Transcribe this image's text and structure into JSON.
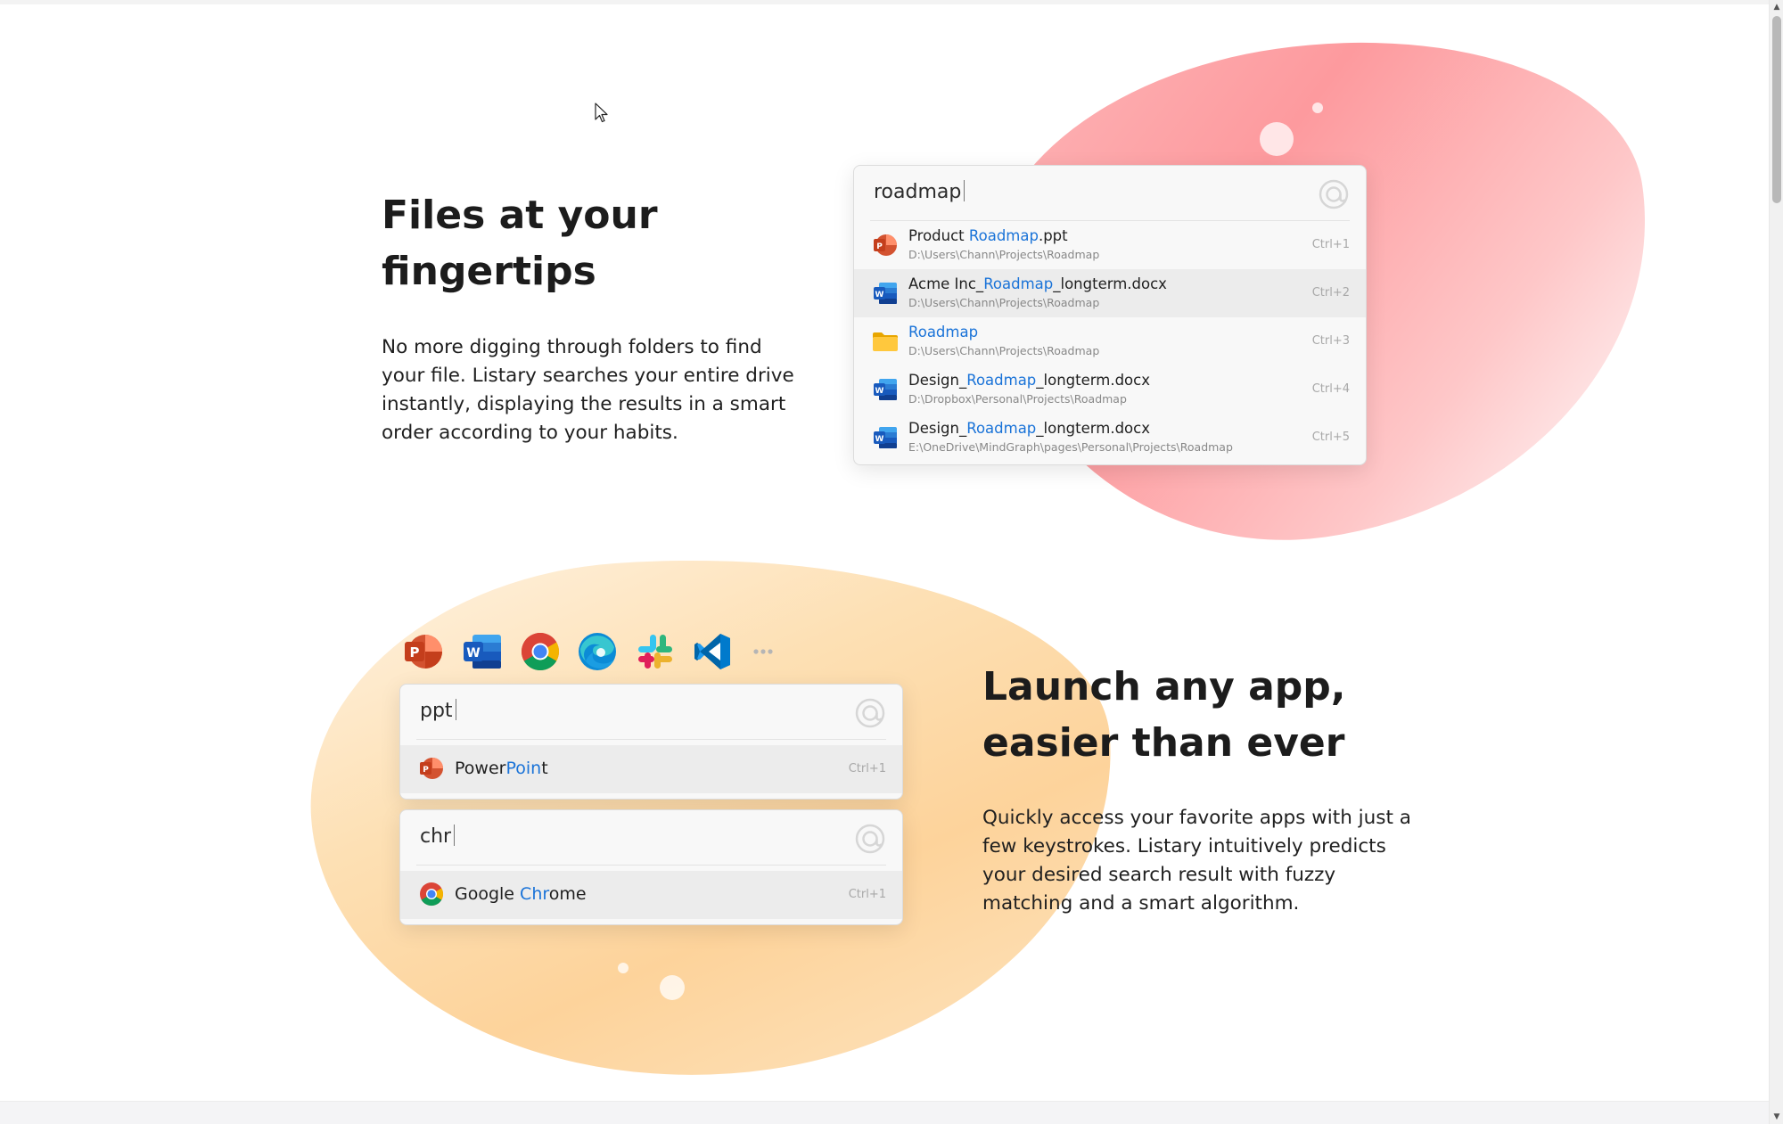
{
  "section1": {
    "heading_line1": "Files at your",
    "heading_line2": "fingertips",
    "para_line1": "No more digging through folders to find",
    "para_line2": "your file. Listary searches your entire drive",
    "para_line3": "instantly, displaying the results in a smart",
    "para_line4": "order according to your habits.",
    "search": {
      "query": "roadmap",
      "results": [
        {
          "pre": "Product ",
          "hl": "Roadmap",
          "post": ".ppt",
          "path": "D:\\Users\\Chann\\Projects\\Roadmap",
          "shortcut": "Ctrl+1",
          "icon": "powerpoint-icon"
        },
        {
          "pre": "Acme Inc_",
          "hl": "Roadmap",
          "post": "_longterm.docx",
          "path": "D:\\Users\\Chann\\Projects\\Roadmap",
          "shortcut": "Ctrl+2",
          "icon": "word-icon"
        },
        {
          "pre": "",
          "hl": "Roadmap",
          "post": "",
          "path": "D:\\Users\\Chann\\Projects\\Roadmap",
          "shortcut": "Ctrl+3",
          "icon": "folder-icon"
        },
        {
          "pre": "Design_",
          "hl": "Roadmap",
          "post": "_longterm.docx",
          "path": "D:\\Dropbox\\Personal\\Projects\\Roadmap",
          "shortcut": "Ctrl+4",
          "icon": "word-icon"
        },
        {
          "pre": "Design_",
          "hl": "Roadmap",
          "post": "_longterm.docx",
          "path": "E:\\OneDrive\\MindGraph\\pages\\Personal\\Projects\\Roadmap",
          "shortcut": "Ctrl+5",
          "icon": "word-icon"
        }
      ]
    }
  },
  "section2": {
    "heading_line1": "Launch any app,",
    "heading_line2": "easier than ever",
    "para_line1": "Quickly access your favorite apps with just a",
    "para_line2": "few keystrokes. Listary intuitively predicts",
    "para_line3": "your desired search result with fuzzy",
    "para_line4": "matching and a smart algorithm.",
    "app_icons": [
      "powerpoint-icon",
      "word-icon",
      "chrome-icon",
      "edge-icon",
      "slack-icon",
      "vscode-icon",
      "more-dots-icon"
    ],
    "search1": {
      "query": "ppt",
      "pre": "Power",
      "hl": "Poin",
      "post": "t",
      "shortcut": "Ctrl+1",
      "icon": "powerpoint-icon"
    },
    "search2": {
      "query": "chr",
      "pre": "Google ",
      "hl": "Chr",
      "post": "ome",
      "shortcut": "Ctrl+1",
      "icon": "chrome-icon"
    }
  },
  "colors": {
    "accent": "#1a73d8",
    "pink_blob": "#fd9a9e",
    "orange_blob": "#fdd39b"
  }
}
